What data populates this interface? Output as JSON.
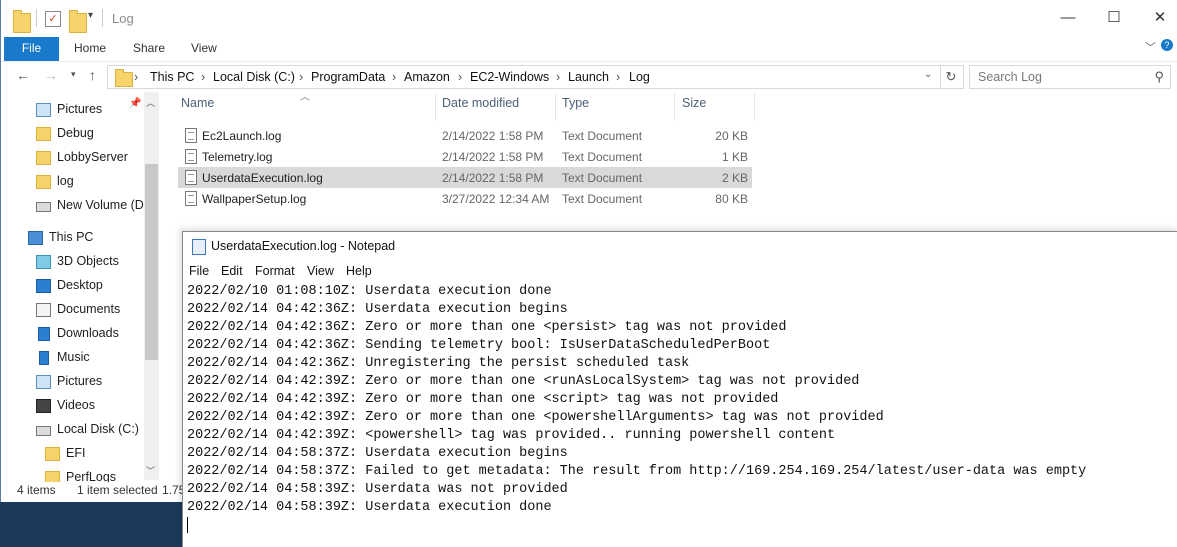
{
  "titlebar": {
    "title": "Log"
  },
  "ribbon": {
    "tabs": [
      "File",
      "Home",
      "Share",
      "View"
    ]
  },
  "address": {
    "crumbs": [
      "This PC",
      "Local Disk (C:)",
      "ProgramData",
      "Amazon",
      "EC2-Windows",
      "Launch",
      "Log"
    ],
    "search_placeholder": "Search Log"
  },
  "nav": {
    "items": [
      {
        "label": "Pictures",
        "icon": "pictures-icon"
      },
      {
        "label": "Debug",
        "icon": "folder-icon"
      },
      {
        "label": "LobbyServer",
        "icon": "folder-icon"
      },
      {
        "label": "log",
        "icon": "folder-icon"
      },
      {
        "label": "New Volume (D:)",
        "icon": "drive-icon"
      },
      {
        "label": "This PC",
        "icon": "computer-icon"
      },
      {
        "label": "3D Objects",
        "icon": "3d-objects-icon"
      },
      {
        "label": "Desktop",
        "icon": "desktop-icon"
      },
      {
        "label": "Documents",
        "icon": "documents-icon"
      },
      {
        "label": "Downloads",
        "icon": "downloads-icon"
      },
      {
        "label": "Music",
        "icon": "music-icon"
      },
      {
        "label": "Pictures",
        "icon": "pictures-icon"
      },
      {
        "label": "Videos",
        "icon": "videos-icon"
      },
      {
        "label": "Local Disk (C:)",
        "icon": "drive-icon"
      },
      {
        "label": "EFI",
        "icon": "folder-icon"
      },
      {
        "label": "PerfLogs",
        "icon": "folder-icon"
      }
    ]
  },
  "files": {
    "columns": [
      "Name",
      "Date modified",
      "Type",
      "Size"
    ],
    "rows": [
      {
        "name": "Ec2Launch.log",
        "date": "2/14/2022 1:58 PM",
        "type": "Text Document",
        "size": "20 KB"
      },
      {
        "name": "Telemetry.log",
        "date": "2/14/2022 1:58 PM",
        "type": "Text Document",
        "size": "1 KB"
      },
      {
        "name": "UserdataExecution.log",
        "date": "2/14/2022 1:58 PM",
        "type": "Text Document",
        "size": "2 KB"
      },
      {
        "name": "WallpaperSetup.log",
        "date": "3/27/2022 12:34 AM",
        "type": "Text Document",
        "size": "80 KB"
      }
    ],
    "selected_index": 2
  },
  "status": {
    "count": "4 items",
    "selection": "1 item selected",
    "size_partial": "1.75"
  },
  "notepad": {
    "title": "UserdataExecution.log - Notepad",
    "menu": [
      "File",
      "Edit",
      "Format",
      "View",
      "Help"
    ],
    "lines": [
      "2022/02/10 01:08:10Z: Userdata execution done",
      "2022/02/14 04:42:36Z: Userdata execution begins",
      "2022/02/14 04:42:36Z: Zero or more than one <persist> tag was not provided",
      "2022/02/14 04:42:36Z: Sending telemetry bool: IsUserDataScheduledPerBoot",
      "2022/02/14 04:42:36Z: Unregistering the persist scheduled task",
      "2022/02/14 04:42:39Z: Zero or more than one <runAsLocalSystem> tag was not provided",
      "2022/02/14 04:42:39Z: Zero or more than one <script> tag was not provided",
      "2022/02/14 04:42:39Z: Zero or more than one <powershellArguments> tag was not provided",
      "2022/02/14 04:42:39Z: <powershell> tag was provided.. running powershell content",
      "2022/02/14 04:58:37Z: Userdata execution begins",
      "2022/02/14 04:58:37Z: Failed to get metadata: The result from http://169.254.169.254/latest/user-data was empty",
      "2022/02/14 04:58:39Z: Userdata was not provided",
      "2022/02/14 04:58:39Z: Userdata execution done"
    ]
  }
}
